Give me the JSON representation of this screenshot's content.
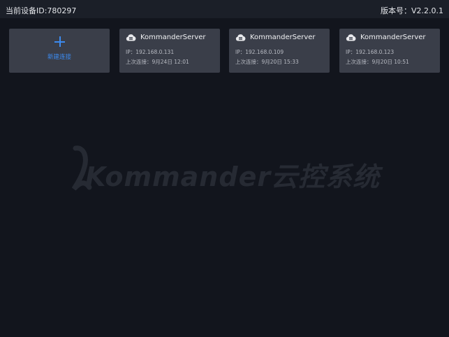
{
  "header": {
    "device_id": "当前设备ID:780297",
    "version": "版本号：V2.2.0.1"
  },
  "new_connection": {
    "label": "新建连接"
  },
  "servers": [
    {
      "name": "KommanderServer",
      "ip": "IP：192.168.0.131",
      "last": "上次连接：9月24日 12:01"
    },
    {
      "name": "KommanderServer",
      "ip": "IP：192.168.0.109",
      "last": "上次连接：9月20日 15:33"
    },
    {
      "name": "KommanderServer",
      "ip": "IP：192.168.0.123",
      "last": "上次连接：9月20日 10:51"
    }
  ],
  "watermark": {
    "text": "Kommander云控系统"
  },
  "colors": {
    "background": "#12151d",
    "card": "#3a3e49",
    "accent": "#3c8bf0"
  },
  "icons": {
    "server": "cloud-server-icon",
    "add": "plus-icon"
  }
}
